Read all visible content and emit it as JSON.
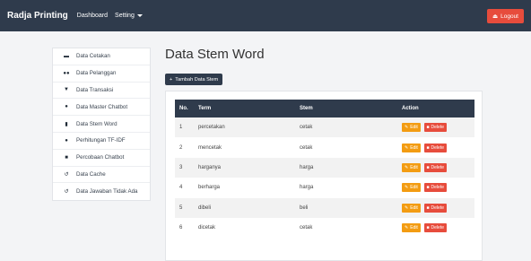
{
  "navbar": {
    "brand": "Radja Printing",
    "links": [
      "Dashboard",
      "Setting"
    ],
    "logout_label": "Logout"
  },
  "sidebar": {
    "items": [
      {
        "label": "Data Cetakan",
        "icon": "book-icon"
      },
      {
        "label": "Data Pelanggan",
        "icon": "users-icon"
      },
      {
        "label": "Data Transaksi",
        "icon": "cart-icon"
      },
      {
        "label": "Data Master Chatbot",
        "icon": "chat-icon"
      },
      {
        "label": "Data Stem Word",
        "icon": "file-icon"
      },
      {
        "label": "Perhitungan TF-IDF",
        "icon": "chat-icon"
      },
      {
        "label": "Percobaan Chatbot",
        "icon": "comment-icon"
      },
      {
        "label": "Data Cache",
        "icon": "history-icon"
      },
      {
        "label": "Data Jawaban Tidak Ada",
        "icon": "history-icon"
      }
    ]
  },
  "main": {
    "title": "Data Stem Word",
    "add_label": "Tambah Data Stem",
    "table": {
      "headers": [
        "No.",
        "Term",
        "Stem",
        "Action"
      ],
      "rows": [
        {
          "no": "1",
          "term": "percetakan",
          "stem": "cetak"
        },
        {
          "no": "2",
          "term": "mencetak",
          "stem": "cetak"
        },
        {
          "no": "3",
          "term": "harganya",
          "stem": "harga"
        },
        {
          "no": "4",
          "term": "berharga",
          "stem": "harga"
        },
        {
          "no": "5",
          "term": "dibeli",
          "stem": "beli"
        },
        {
          "no": "6",
          "term": "dicetak",
          "stem": "cetak"
        }
      ],
      "edit_label": "Edit",
      "delete_label": "Delete"
    }
  },
  "colors": {
    "navbar": "#2f3b4c",
    "logout": "#e74c3c",
    "edit": "#f39c12",
    "delete": "#e74c3c"
  }
}
